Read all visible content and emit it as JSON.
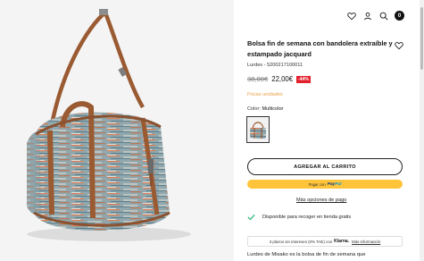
{
  "header": {
    "icons": [
      "heart-icon",
      "user-icon",
      "search-icon",
      "cart-icon"
    ],
    "cart_count": "0"
  },
  "product": {
    "title": "Bolsa fin de semana con bandolera extraíble y estampado jacquard",
    "reference": "Lurdes - 5200217100011",
    "old_price": "38,00€",
    "new_price": "22,00€",
    "discount": "-44%",
    "stock_message": "Pocas unidades",
    "color_label": "Color:",
    "color_value": "Multicolor"
  },
  "actions": {
    "add_to_cart": "AGREGAR AL CARRITO",
    "paypal_prefix": "Pagar con",
    "paypal_brand_a": "Pay",
    "paypal_brand_b": "Pal",
    "more_payment": "Más opciones de pago"
  },
  "pickup": {
    "text": "Disponible para recoger en tienda gratis"
  },
  "klarna": {
    "prefix": "3 plazos sin intereses (0% TAE) con",
    "brand": "Klarna.",
    "link": "Más información"
  },
  "description": {
    "text": "Lurdes de Misako es la bolsa de fin de semana que"
  },
  "colors": {
    "discount_badge": "#e2202b",
    "stock": "#e8a045",
    "paypal_button": "#ffc439",
    "check": "#2bb673",
    "strap": "#9a5a32"
  }
}
